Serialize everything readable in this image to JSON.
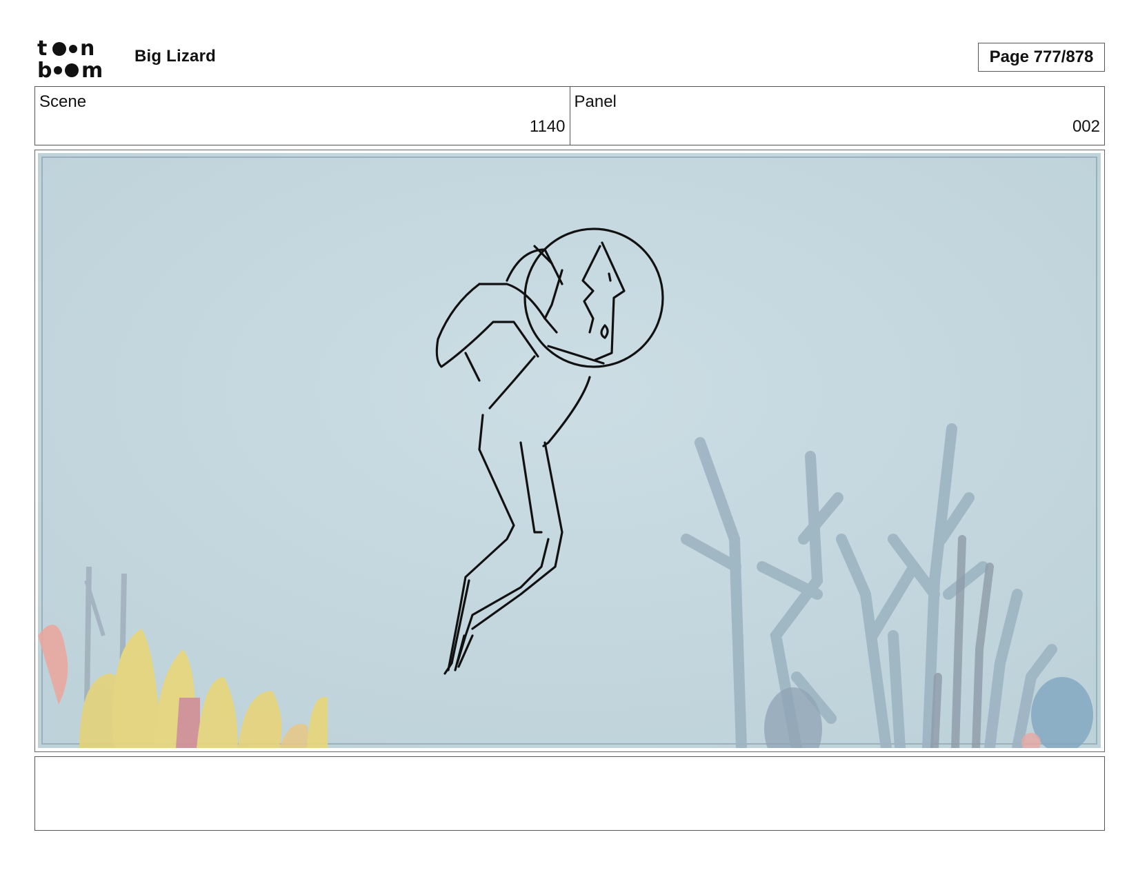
{
  "header": {
    "logo_text": "toon boom",
    "project_title": "Big Lizard",
    "page_indicator": "Page 777/878"
  },
  "info": {
    "scene_label": "Scene",
    "scene_value": "1140",
    "panel_label": "Panel",
    "panel_value": "002"
  },
  "panel_image": {
    "description_icon": "storyboard-panel-drawing",
    "background_color": "#c5d8e0"
  },
  "notes": {
    "text": ""
  }
}
